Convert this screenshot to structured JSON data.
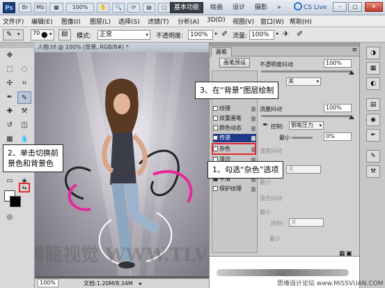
{
  "titlebar": {
    "logo": "Ps",
    "icons": [
      "Br",
      "Mb"
    ],
    "zoom": "100%",
    "workspaces": [
      "基本功能",
      "绘画",
      "设计",
      "摄影"
    ],
    "more": "»",
    "cslive": "CS Live"
  },
  "menu": [
    "文件(F)",
    "编辑(E)",
    "图像(I)",
    "图层(L)",
    "选择(S)",
    "滤镜(T)",
    "分析(A)",
    "3D(D)",
    "视图(V)",
    "窗口(W)",
    "帮助(H)"
  ],
  "options": {
    "brush_size": "70",
    "mode_label": "模式:",
    "mode_value": "正常",
    "opacity_label": "不透明度:",
    "opacity_value": "100%",
    "flow_label": "流量:",
    "flow_value": "100%"
  },
  "document": {
    "tab_title": "人物.tif @ 100% (背景, RGB/8#) *",
    "zoom": "100%",
    "file_info": "文档:1.20M/8.34M"
  },
  "brush_panel": {
    "tab": "画笔",
    "presets_button": "画笔预设",
    "options": [
      {
        "label": "纹理",
        "checked": false
      },
      {
        "label": "双重画笔",
        "checked": false
      },
      {
        "label": "颜色动态",
        "checked": false
      },
      {
        "label": "传递",
        "checked": true
      },
      {
        "label": "杂色",
        "checked": false
      },
      {
        "label": "湿边",
        "checked": false
      },
      {
        "label": "喷枪",
        "checked": false
      },
      {
        "label": "平滑",
        "checked": true
      },
      {
        "label": "保护纹理",
        "checked": false
      }
    ],
    "opacity_jitter_label": "不透明度抖动",
    "opacity_jitter_value": "100%",
    "flow_jitter_label": "流量抖动",
    "flow_jitter_value": "100%",
    "control_label": "控制:",
    "control_value": "钢笔压力",
    "min_label": "最小",
    "min_value": "0%",
    "wetness_label": "湿度抖动",
    "mix_label": "混合抖动",
    "control2_value": "关",
    "dim_min": "最小",
    "off_value": "关"
  },
  "callouts": {
    "step1": "1、勾选“杂色”选项",
    "step2_line1": "2、单击切换前",
    "step2_line2": "景色和背景色",
    "step3": "3、在“背景”图层绘制"
  },
  "watermarks": {
    "main": "腾龍视觉  WWW.TLVI.NET",
    "bottom_right": "思缘设计论坛 www.MISSVUAN.COM"
  },
  "colors": {
    "highlight": "#1f3a8a",
    "callout_box": "#e8262c",
    "active_workspace": "#3b3f48"
  }
}
